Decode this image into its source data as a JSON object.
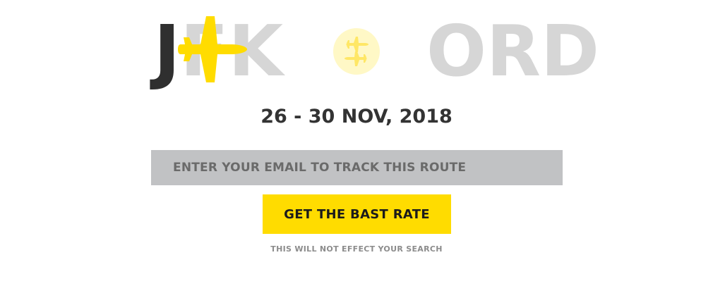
{
  "route": {
    "origin_flown": "J",
    "origin_rest": "FK",
    "destination": "ORD",
    "icons": {
      "origin_plane": "airplane-icon",
      "swap": "swap-direction-icon"
    }
  },
  "dates": "26 - 30 NOV, 2018",
  "email": {
    "placeholder": "ENTER YOUR EMAIL TO TRACK THIS ROUTE",
    "value": ""
  },
  "cta": {
    "label": "GET THE BAST RATE"
  },
  "note": "THIS WILL NOT EFFECT YOUR SEARCH",
  "colors": {
    "accent": "#ffdc00",
    "swap_bg": "#fff8c6",
    "code_muted": "#d6d6d6",
    "code_dark": "#2f2f2f",
    "field_bg": "#c1c2c4"
  }
}
